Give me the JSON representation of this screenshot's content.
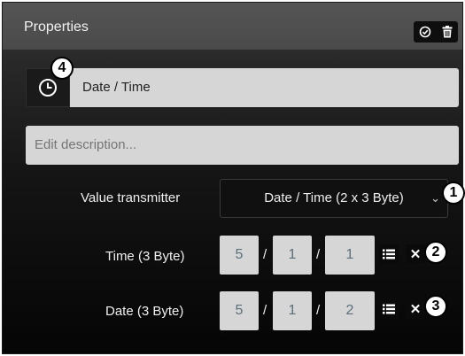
{
  "header": {
    "title": "Properties",
    "icons": [
      "check-circle-icon",
      "trash-icon"
    ]
  },
  "name_field": {
    "icon": "clock-icon",
    "value": "Date / Time"
  },
  "description": {
    "placeholder": "Edit description..."
  },
  "value_transmitter": {
    "label": "Value transmitter",
    "selected": "Date / Time (2 x 3 Byte)"
  },
  "time": {
    "label": "Time (3 Byte)",
    "values": [
      "5",
      "1",
      "1"
    ],
    "separator": "/"
  },
  "date": {
    "label": "Date (3 Byte)",
    "values": [
      "5",
      "1",
      "2"
    ],
    "separator": "/"
  },
  "callouts": [
    "1",
    "2",
    "3",
    "4"
  ]
}
